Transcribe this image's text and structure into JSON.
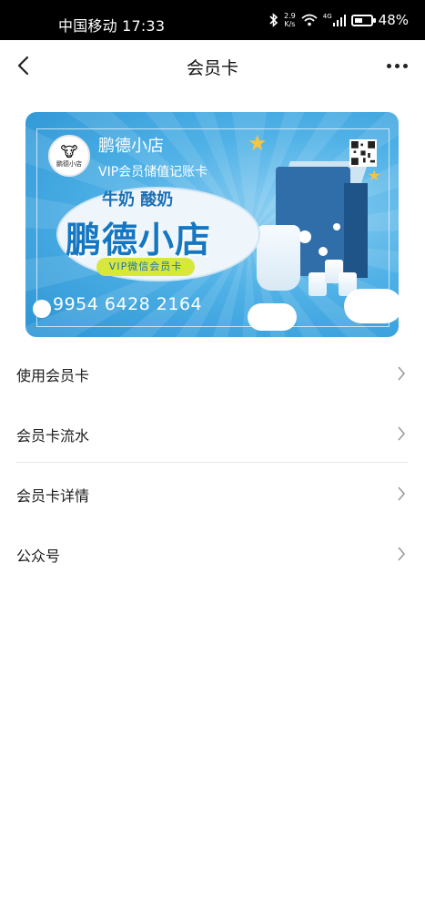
{
  "status_bar": {
    "carrier_time": "中国移动 17:33",
    "speed_value": "2.9",
    "speed_unit": "K/s",
    "network": "4G",
    "battery": "48%",
    "battery_level": 0.48
  },
  "nav": {
    "title": "会员卡"
  },
  "card": {
    "shop_name": "鹏德小店",
    "card_type": "VIP会员储值记账卡",
    "avatar_text": "鹏德小店",
    "logo_top": "牛奶 酸奶",
    "logo_main": "鹏德小店",
    "logo_badge": "VIP微信会员卡",
    "card_number": "9954 6428 2164"
  },
  "menu": {
    "items": [
      {
        "label": "使用会员卡"
      },
      {
        "label": "会员卡流水"
      },
      {
        "label": "会员卡详情"
      },
      {
        "label": "公众号"
      }
    ]
  },
  "colors": {
    "status_bar_bg": "#000000",
    "card_blue": "#2d95d5",
    "logo_blue": "#1577c2",
    "badge_yellow": "#d8e83a",
    "divider": "#e6e6e6"
  },
  "icons": [
    "back-arrow-icon",
    "more-icon",
    "bluetooth-icon",
    "wifi-icon",
    "signal-icon",
    "battery-icon",
    "qr-code-icon",
    "chevron-right-icon"
  ]
}
